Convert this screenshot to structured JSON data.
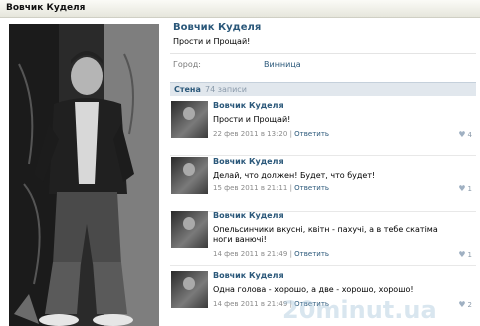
{
  "header": {
    "title": "Вовчик Куделя"
  },
  "profile": {
    "name": "Вовчик Куделя",
    "status": "Прости и Прощай!",
    "city_label": "Город:",
    "city_value": "Винница"
  },
  "wall": {
    "title": "Стена",
    "count": "74 записи",
    "posts": [
      {
        "author": "Вовчик Куделя",
        "text": "Прости и Прощай!",
        "date": "22 фев 2011 в 13:20",
        "sep": "|",
        "reply": "Ответить",
        "likes": "4"
      },
      {
        "author": "Вовчик Куделя",
        "text": "Делай, что должен! Будет, что будет!",
        "date": "15 фев 2011 в 21:11",
        "sep": "|",
        "reply": "Ответить",
        "likes": "1"
      },
      {
        "author": "Вовчик Куделя",
        "text": "Опельсинчики вкусні, квітн - пахучі, а в тебе скатіма ноги ванючі!",
        "date": "14 фев 2011 в 21:49",
        "sep": "|",
        "reply": "Ответить",
        "likes": "1"
      },
      {
        "author": "Вовчик Куделя",
        "text": "Одна голова - хорошо, а две - хорошо, хорошо!",
        "date": "14 фев 2011 в 21:49",
        "sep": "|",
        "reply": "Ответить",
        "likes": "2"
      }
    ]
  },
  "watermark": "20minut.ua",
  "colors": {
    "link": "#2b587a",
    "wall_header_bg": "#e1e7ed"
  }
}
